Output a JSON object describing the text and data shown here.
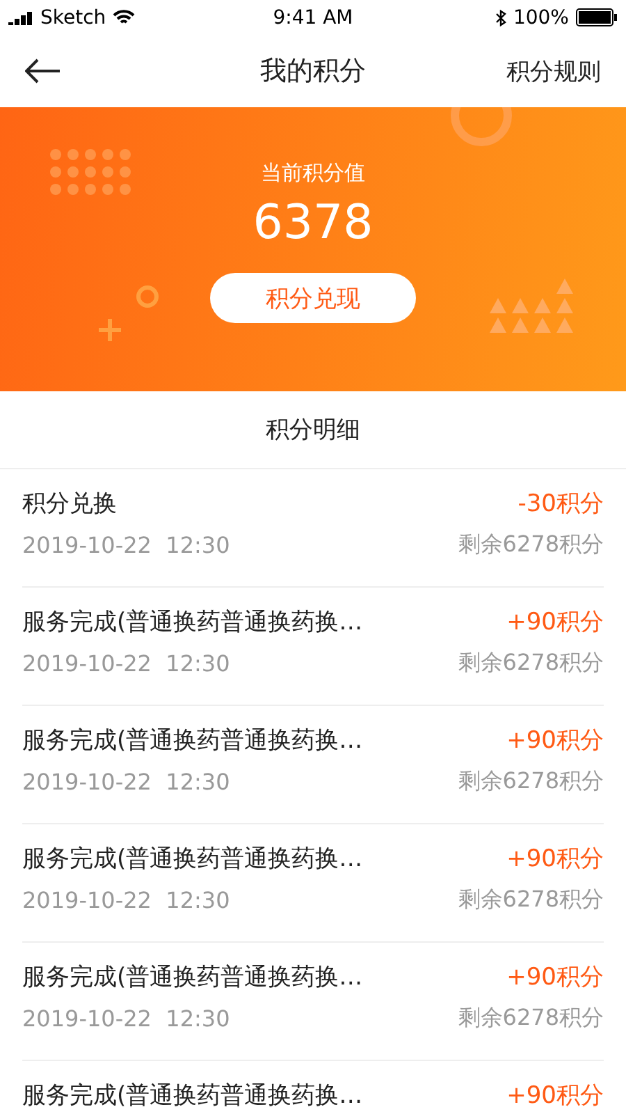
{
  "status_bar": {
    "carrier": "Sketch",
    "time": "9:41 AM",
    "battery": "100%"
  },
  "nav": {
    "title": "我的积分",
    "action": "积分规则"
  },
  "summary": {
    "label": "当前积分值",
    "value": "6378",
    "button": "积分兑现"
  },
  "section_title": "积分明细",
  "records": [
    {
      "title": "积分兑换",
      "points": "-30积分",
      "date": "2019-10-22  12:30",
      "balance": "剩余6278积分"
    },
    {
      "title": "服务完成(普通换药普通换药换…",
      "points": "+90积分",
      "date": "2019-10-22  12:30",
      "balance": "剩余6278积分"
    },
    {
      "title": "服务完成(普通换药普通换药换…",
      "points": "+90积分",
      "date": "2019-10-22  12:30",
      "balance": "剩余6278积分"
    },
    {
      "title": "服务完成(普通换药普通换药换…",
      "points": "+90积分",
      "date": "2019-10-22  12:30",
      "balance": "剩余6278积分"
    },
    {
      "title": "服务完成(普通换药普通换药换…",
      "points": "+90积分",
      "date": "2019-10-22  12:30",
      "balance": "剩余6278积分"
    },
    {
      "title": "服务完成(普通换药普通换药换…",
      "points": "+90积分"
    }
  ]
}
